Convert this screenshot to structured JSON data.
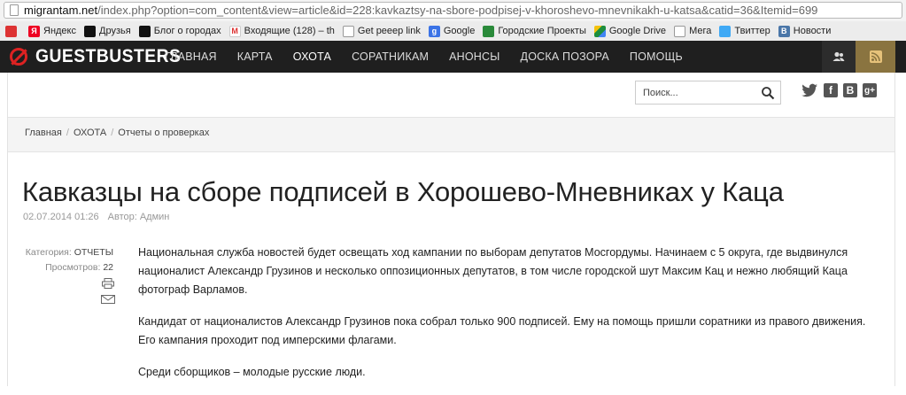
{
  "browser": {
    "url_host": "migrantam.net",
    "url_path": "/index.php?option=com_content&view=article&id=228:kavkaztsy-na-sbore-podpisej-v-khoroshevo-mnevnikakh-u-katsa&catid=36&Itemid=699"
  },
  "bookmarks": [
    {
      "label": "Яндекс",
      "icon": "yandex-icon"
    },
    {
      "label": "Друзья",
      "icon": "spy-icon"
    },
    {
      "label": "Блог о городах",
      "icon": "spy-icon"
    },
    {
      "label": "Входящие (128) – th",
      "icon": "gmail-icon"
    },
    {
      "label": "Get peeep link",
      "icon": "page-icon"
    },
    {
      "label": "Google",
      "icon": "google-icon"
    },
    {
      "label": "Городские Проекты",
      "icon": "projects-icon"
    },
    {
      "label": "Google Drive",
      "icon": "google-drive-icon"
    },
    {
      "label": "Мега",
      "icon": "page-icon"
    },
    {
      "label": "Твиттер",
      "icon": "twitter-icon"
    },
    {
      "label": "Новости",
      "icon": "vk-icon"
    }
  ],
  "site": {
    "logo_text": "GUESTBUSTERS",
    "nav": [
      "ГЛАВНАЯ",
      "КАРТА",
      "ОХОТА",
      "СОРАТНИКАМ",
      "АНОНСЫ",
      "ДОСКА ПОЗОРА",
      "ПОМОЩЬ"
    ],
    "active_nav": "ОХОТА",
    "rss_color": "#8a7440"
  },
  "search": {
    "placeholder": "Поиск..."
  },
  "social": [
    "twitter-icon",
    "facebook-icon",
    "vk-icon",
    "google-plus-icon"
  ],
  "breadcrumb": [
    "Главная",
    "ОХОТА",
    "Отчеты о проверках"
  ],
  "article": {
    "title": "Кавказцы на сборе подписей в Хорошево-Мневниках у Каца",
    "date": "02.07.2014 01:26",
    "author": "Автор: Админ",
    "category_label": "Категория:",
    "category_value": "ОТЧЕТЫ",
    "views_label": "Просмотров:",
    "views_value": "22",
    "paragraphs": [
      "Национальная служба новостей будет освещать ход кампании по выборам депутатов Мосгордумы. Начинаем с 5 округа, где выдвинулся националист Александр Грузинов и несколько оппозиционных депутатов, в том числе городской шут Максим Кац и нежно любящий Каца фотограф Варламов.",
      "Кандидат от националистов  Александр Грузинов пока собрал только 900 подписей. Ему на помощь пришли соратники из правого движения. Его кампания проходит под имперскими флагами.",
      "Среди сборщиков – молодые русские люди."
    ]
  }
}
